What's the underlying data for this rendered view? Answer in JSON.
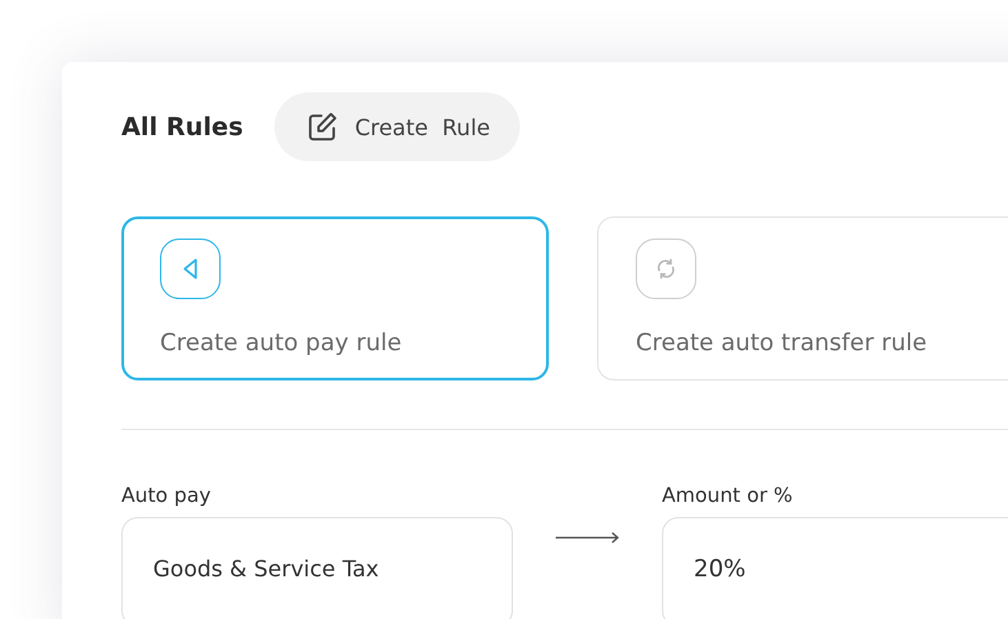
{
  "header": {
    "title": "All Rules",
    "create_button": "Create  Rule"
  },
  "rule_options": [
    {
      "kind": "pay",
      "label": "Create auto pay rule",
      "selected": true
    },
    {
      "kind": "transfer",
      "label": "Create auto transfer rule",
      "selected": false
    }
  ],
  "form": {
    "source": {
      "label": "Auto pay",
      "value": "Goods & Service Tax"
    },
    "amount": {
      "label": "Amount or %",
      "value": "20%"
    }
  }
}
